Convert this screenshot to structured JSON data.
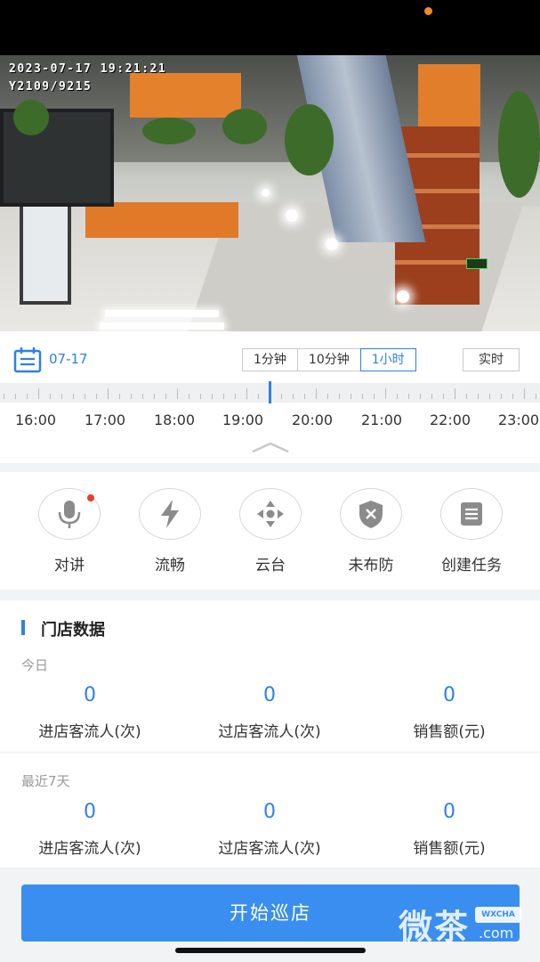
{
  "video": {
    "timestamp": "2023-07-17 19:21:21",
    "device_id": "Y2109/9215"
  },
  "playback": {
    "date": "07-17",
    "zoom_options": [
      "1分钟",
      "10分钟",
      "1小时"
    ],
    "selected_zoom": "1小时",
    "realtime_label": "实时",
    "hours": [
      "16:00",
      "17:00",
      "18:00",
      "19:00",
      "20:00",
      "21:00",
      "22:00",
      "23:00"
    ]
  },
  "actions": [
    {
      "label": "对讲",
      "icon": "microphone-icon"
    },
    {
      "label": "流畅",
      "icon": "lightning-icon"
    },
    {
      "label": "云台",
      "icon": "ptz-arrows-icon"
    },
    {
      "label": "未布防",
      "icon": "shield-x-icon"
    },
    {
      "label": "创建任务",
      "icon": "document-list-icon"
    }
  ],
  "store_data": {
    "title": "门店数据",
    "today": {
      "label": "今日",
      "metrics": [
        {
          "value": "0",
          "caption": "进店客流人(次)"
        },
        {
          "value": "0",
          "caption": "过店客流人(次)"
        },
        {
          "value": "0",
          "caption": "销售额(元)"
        }
      ]
    },
    "last7": {
      "label": "最近7天",
      "metrics": [
        {
          "value": "0",
          "caption": "进店客流人(次)"
        },
        {
          "value": "0",
          "caption": "过店客流人(次)"
        },
        {
          "value": "0",
          "caption": "销售额(元)"
        }
      ]
    }
  },
  "start_button": "开始巡店",
  "watermark": {
    "main": "微茶",
    "badge": "WXCHA",
    "domain": ".com"
  },
  "colors": {
    "accent": "#2f7fe8",
    "button": "#3a8ef0",
    "notify": "#e8402f",
    "status_dot": "#f08a24"
  }
}
